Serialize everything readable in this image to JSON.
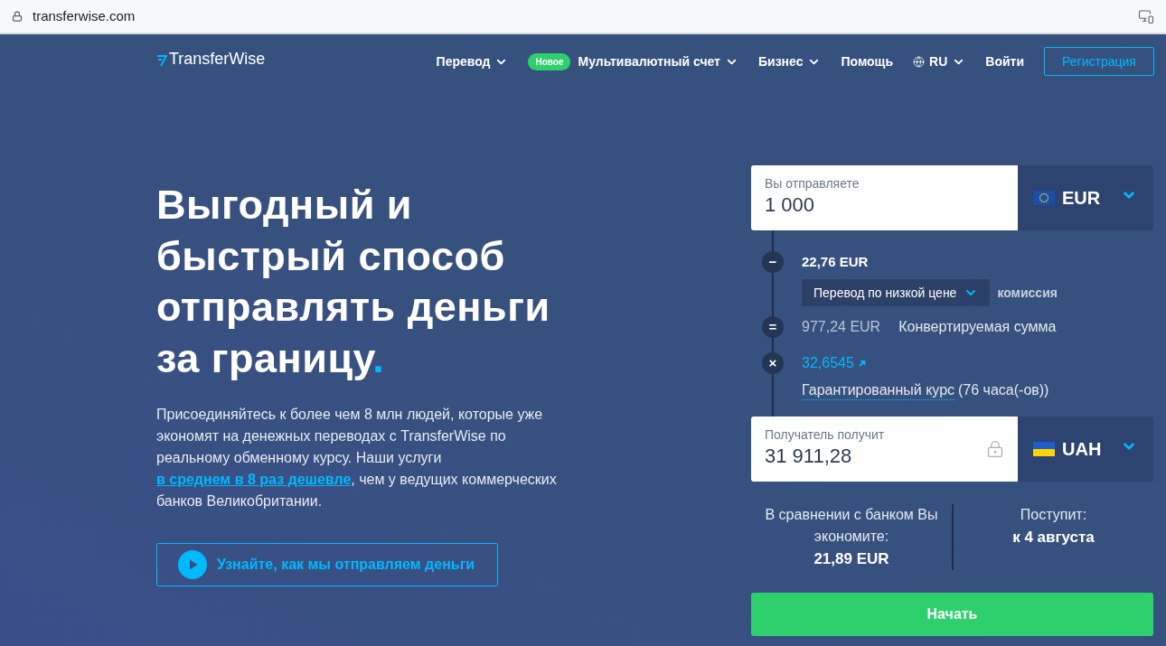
{
  "browser": {
    "url": "transferwise.com"
  },
  "nav": {
    "logo": "TransferWise",
    "items": [
      {
        "kind": "dropdown",
        "label": "Перевод"
      },
      {
        "kind": "dropdown",
        "label": "Мультивалютный счет",
        "badge": "Новое"
      },
      {
        "kind": "dropdown",
        "label": "Бизнес"
      },
      {
        "kind": "link",
        "label": "Помощь"
      },
      {
        "kind": "language",
        "label": "RU"
      },
      {
        "kind": "link",
        "label": "Войти"
      },
      {
        "kind": "button",
        "label": "Регистрация"
      }
    ]
  },
  "hero": {
    "headline": [
      "Выгодный и",
      "быстрый способ",
      "отправлять деньги",
      "за границу"
    ],
    "headline_accent": ".",
    "body": [
      {
        "kind": "text",
        "text": "Присоединяйтесь к более чем 8 млн людей, которые уже экономят на денежных переводах с TransferWise по реальному обменному курсу. Наши услуги "
      },
      {
        "kind": "link",
        "text": "в среднем в 8 раз дешевле"
      },
      {
        "kind": "text",
        "text": ", чем у ведущих коммерческих банков Великобритании."
      }
    ],
    "video_button": "Узнайте, как мы отправляем деньги"
  },
  "calculator": {
    "send": {
      "kind": "eu",
      "label": "Вы отправляете",
      "value": "1 000",
      "currency": "EUR"
    },
    "steps": [
      {
        "kind": "fee",
        "symbol": "−",
        "amount": "22,76 EUR",
        "option": "Перевод по низкой цене",
        "label": "комиссия"
      },
      {
        "kind": "converted",
        "symbol": "=",
        "amount": "977,24 EUR",
        "label": "Конвертируемая сумма"
      },
      {
        "kind": "rate",
        "symbol": "×",
        "amount": "32,6545",
        "label": "Гарантированный курс",
        "note": "(76 часа(-ов))"
      }
    ],
    "receive": {
      "kind": "ua",
      "label": "Получатель получит",
      "value": "31 911,28",
      "currency": "UAH"
    },
    "summary": {
      "savings_label": "В сравнении с банком Вы экономите:",
      "savings_value": "21,89 EUR",
      "arrival_label": "Поступит:",
      "arrival_value": "к 4 августа"
    },
    "start_button": "Начать"
  }
}
